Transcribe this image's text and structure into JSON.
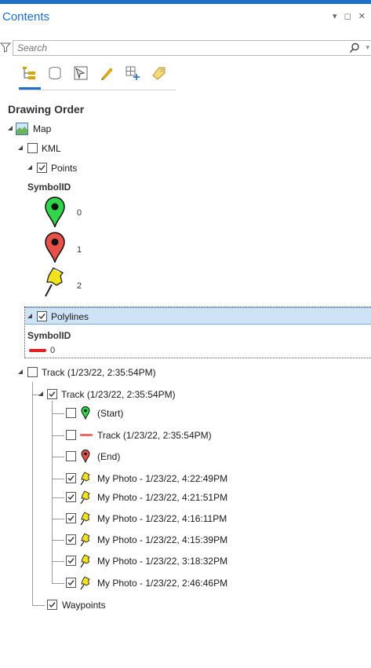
{
  "window": {
    "title": "Contents",
    "controls": "▾ ◻ ✕"
  },
  "search": {
    "placeholder": "Search"
  },
  "toolbar": {
    "tools": [
      "list-by-drawing-order-icon",
      "list-by-data-source-icon",
      "list-by-selection-icon",
      "list-by-editing-icon",
      "list-by-snapping-icon",
      "list-by-labeling-icon"
    ]
  },
  "section": {
    "heading": "Drawing Order"
  },
  "tree": {
    "map": "Map",
    "kml": "KML",
    "points": "Points",
    "points_field": "SymbolID",
    "points_symbols": [
      "0",
      "1",
      "2"
    ],
    "polylines": "Polylines",
    "polylines_field": "SymbolID",
    "polylines_symbol": "0",
    "track_group": "Track (1/23/22, 2:35:54PM)",
    "track_sub": "Track (1/23/22, 2:35:54PM)",
    "start": "(Start)",
    "track_line": "Track (1/23/22, 2:35:54PM)",
    "end": "(End)",
    "photos": [
      "My Photo - 1/23/22, 4:22:49PM",
      "My Photo - 1/23/22, 4:21:51PM",
      "My Photo - 1/23/22, 4:16:11PM",
      "My Photo - 1/23/22, 4:15:39PM",
      "My Photo - 1/23/22, 3:18:32PM",
      "My Photo - 1/23/22, 2:46:46PM"
    ],
    "waypoints": "Waypoints"
  },
  "colors": {
    "accent": "#1f6fc5",
    "selection": "#cfe3f6",
    "green_pin": "#2fd64a",
    "red_pin": "#e8504a",
    "yellow_pin": "#f2e21a",
    "polyline": "#e02020"
  }
}
